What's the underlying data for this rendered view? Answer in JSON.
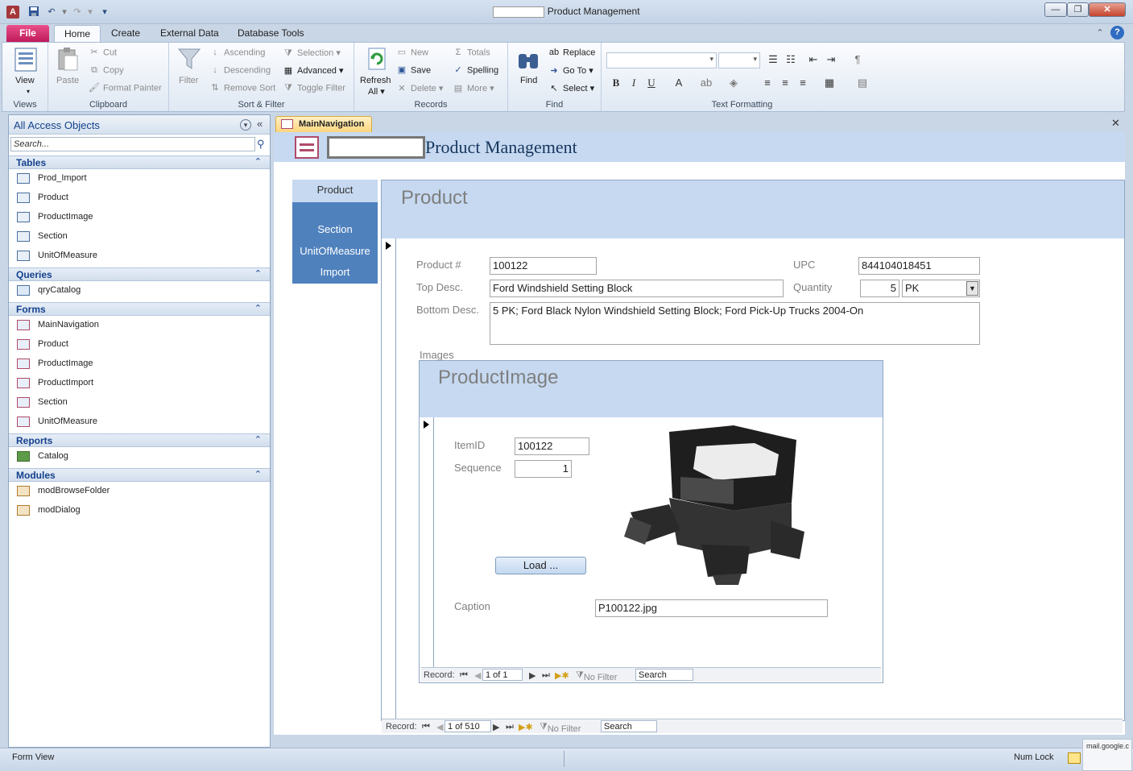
{
  "window": {
    "title": "Product Management",
    "controls": [
      "minimize",
      "restore",
      "close"
    ]
  },
  "quick_access": {
    "icons": [
      "access-logo-icon",
      "save-icon",
      "undo-icon",
      "redo-icon",
      "customize-icon"
    ]
  },
  "ribbon_tabs": [
    {
      "label": "File"
    },
    {
      "label": "Home"
    },
    {
      "label": "Create"
    },
    {
      "label": "External Data"
    },
    {
      "label": "Database Tools"
    }
  ],
  "ribbon": {
    "views": {
      "view": "View",
      "group": "Views"
    },
    "clipboard": {
      "paste": "Paste",
      "cut": "Cut",
      "copy": "Copy",
      "format_painter": "Format Painter",
      "group": "Clipboard"
    },
    "sort_filter": {
      "filter": "Filter",
      "ascending": "Ascending",
      "descending": "Descending",
      "remove_sort": "Remove Sort",
      "selection": "Selection",
      "advanced": "Advanced",
      "toggle_filter": "Toggle Filter",
      "group": "Sort & Filter"
    },
    "records": {
      "refresh": "Refresh",
      "refresh_all": "All",
      "new": "New",
      "save": "Save",
      "delete": "Delete",
      "totals": "Totals",
      "spelling": "Spelling",
      "more": "More",
      "group": "Records"
    },
    "find": {
      "find": "Find",
      "replace": "Replace",
      "go_to": "Go To",
      "select": "Select",
      "group": "Find"
    },
    "text_formatting": {
      "group": "Text Formatting"
    }
  },
  "nav_pane": {
    "title": "All Access Objects",
    "search_placeholder": "Search...",
    "sections": {
      "tables": {
        "label": "Tables",
        "items": [
          "Prod_Import",
          "Product",
          "ProductImage",
          "Section",
          "UnitOfMeasure"
        ]
      },
      "queries": {
        "label": "Queries",
        "items": [
          "qryCatalog"
        ]
      },
      "forms": {
        "label": "Forms",
        "items": [
          "MainNavigation",
          "Product",
          "ProductImage",
          "ProductImport",
          "Section",
          "UnitOfMeasure"
        ]
      },
      "reports": {
        "label": "Reports",
        "items": [
          "Catalog"
        ]
      },
      "modules": {
        "label": "Modules",
        "items": [
          "modBrowseFolder",
          "modDialog"
        ]
      }
    }
  },
  "doc_tab": {
    "label": "MainNavigation"
  },
  "form": {
    "title": "Product Management",
    "nav_menu": [
      "Product",
      "Section",
      "UnitOfMeasure",
      "Import"
    ],
    "product": {
      "header": "Product",
      "product_no_label": "Product #",
      "product_no": "100122",
      "upc_label": "UPC",
      "upc": "844104018451",
      "top_desc_label": "Top Desc.",
      "top_desc": "Ford Windshield Setting Block",
      "quantity_label": "Quantity",
      "quantity": "5",
      "unit": "PK",
      "bottom_desc_label": "Bottom Desc.",
      "bottom_desc": "5 PK; Ford Black Nylon Windshield Setting Block; Ford Pick-Up Trucks 2004-On",
      "images_label": "Images"
    },
    "product_image": {
      "header": "ProductImage",
      "item_id_label": "ItemID",
      "item_id": "100122",
      "sequence_label": "Sequence",
      "sequence": "1",
      "load_button": "Load ...",
      "caption_label": "Caption",
      "caption": "P100122.jpg"
    },
    "sub_record_nav": {
      "record_label": "Record:",
      "position": "1 of 1",
      "filter": "No Filter",
      "search": "Search"
    },
    "main_record_nav": {
      "record_label": "Record:",
      "position": "1 of 510",
      "filter": "No Filter",
      "search": "Search"
    }
  },
  "status_bar": {
    "left": "Form View",
    "num_lock": "Num Lock",
    "tooltip": "mail.google.c"
  },
  "colors": {
    "accent": "#4f81bd",
    "header_fill": "#c6d9f1",
    "file_tab": "#c01a5b"
  }
}
